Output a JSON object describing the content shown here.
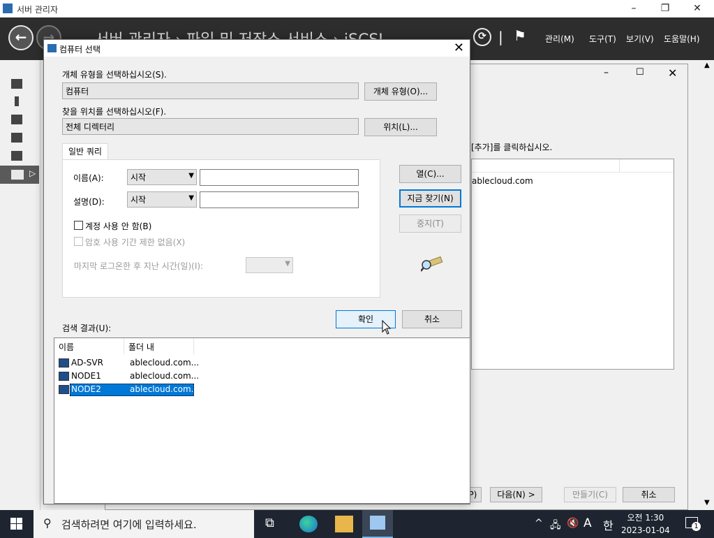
{
  "server_manager": {
    "title": "서버 관리자",
    "breadcrumb": "서버 관리자 › 파일 및 저장소 서비스 › iSCSI",
    "menu": [
      "관리(M)",
      "도구(T)",
      "보기(V)",
      "도움말(H)"
    ]
  },
  "wizard": {
    "instruction": "[추가]를 클릭하십시오.",
    "list_entry": "ablecloud.com",
    "buttons": {
      "prev": "< 이전(P)",
      "next": "다음(N) >",
      "create": "만들기(C)",
      "cancel": "취소"
    }
  },
  "dialog": {
    "title": "컴퓨터 선택",
    "object_type_label": "개체 유형을 선택하십시오(S).",
    "object_type_value": "컴퓨터",
    "object_type_button": "개체 유형(O)...",
    "location_label": "찾을 위치를 선택하십시오(F).",
    "location_value": "전체 디렉터리",
    "location_button": "위치(L)...",
    "tab_label": "일반 쿼리",
    "name_label": "이름(A):",
    "name_combo": "시작",
    "desc_label": "설명(D):",
    "desc_combo": "시작",
    "disabled_accounts": "계정 사용 안 함(B)",
    "non_expiring": "암호 사용 기간 제한 없음(X)",
    "last_logon": "마지막 로그온한 후 지난 시간(일)(I):",
    "buttons": {
      "columns": "열(C)...",
      "find_now": "지금 찾기(N)",
      "stop": "중지(T)",
      "ok": "확인",
      "cancel": "취소"
    },
    "results_label": "검색 결과(U):",
    "columns": [
      "이름",
      "폴더 내"
    ],
    "rows": [
      {
        "name": "AD-SVR",
        "folder": "ablecloud.com...",
        "selected": false
      },
      {
        "name": "NODE1",
        "folder": "ablecloud.com...",
        "selected": false
      },
      {
        "name": "NODE2",
        "folder": "ablecloud.com...",
        "selected": true
      }
    ]
  },
  "taskbar": {
    "search_placeholder": "검색하려면 여기에 입력하세요.",
    "ime_mode": "A",
    "ime_lang": "한",
    "time": "오전 1:30",
    "date": "2023-01-04",
    "notification_count": "1"
  }
}
